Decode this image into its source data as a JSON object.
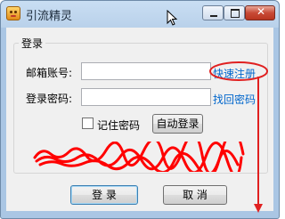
{
  "window": {
    "title": "引流精灵",
    "close_glyph": "✕"
  },
  "form": {
    "group_label": "登录",
    "email_label": "邮箱账号:",
    "email_value": "",
    "password_label": "登录密码:",
    "password_value": "",
    "register_link": "快速注册",
    "forgot_link": "找回密码",
    "remember_label": "记住密码",
    "remember_checked": false,
    "autologin_button": "自动登录",
    "login_button": "登 录",
    "cancel_button": "取 消"
  },
  "annotation": {
    "color": "#e02020"
  }
}
